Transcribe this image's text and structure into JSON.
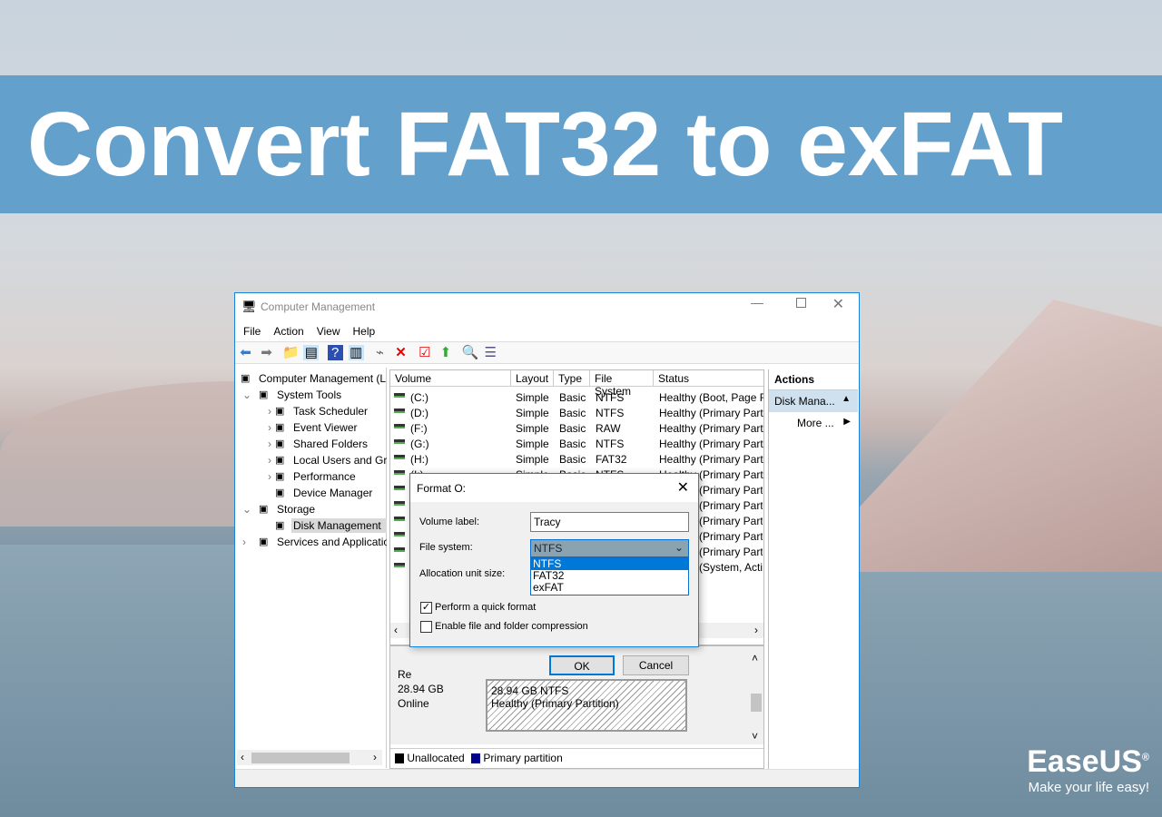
{
  "banner": {
    "title": "Convert FAT32 to exFAT"
  },
  "window": {
    "title": "Computer Management",
    "menu": [
      "File",
      "Action",
      "View",
      "Help"
    ]
  },
  "tree": [
    {
      "label": "Computer Management (L",
      "indent": 0,
      "arrow": ""
    },
    {
      "label": "System Tools",
      "indent": 1,
      "arrow": "v"
    },
    {
      "label": "Task Scheduler",
      "indent": 2,
      "arrow": ">"
    },
    {
      "label": "Event Viewer",
      "indent": 2,
      "arrow": ">"
    },
    {
      "label": "Shared Folders",
      "indent": 2,
      "arrow": ">"
    },
    {
      "label": "Local Users and Gro",
      "indent": 2,
      "arrow": ">"
    },
    {
      "label": "Performance",
      "indent": 2,
      "arrow": ">"
    },
    {
      "label": "Device Manager",
      "indent": 2,
      "arrow": ""
    },
    {
      "label": "Storage",
      "indent": 1,
      "arrow": "v"
    },
    {
      "label": "Disk Management",
      "indent": 2,
      "arrow": "",
      "selected": true
    },
    {
      "label": "Services and Applicatio",
      "indent": 1,
      "arrow": ">"
    }
  ],
  "table": {
    "headers": [
      "Volume",
      "Layout",
      "Type",
      "File System",
      "Status"
    ],
    "rows": [
      [
        "(C:)",
        "Simple",
        "Basic",
        "NTFS",
        "Healthy (Boot, Page F"
      ],
      [
        "(D:)",
        "Simple",
        "Basic",
        "NTFS",
        "Healthy (Primary Part"
      ],
      [
        "(F:)",
        "Simple",
        "Basic",
        "RAW",
        "Healthy (Primary Part"
      ],
      [
        "(G:)",
        "Simple",
        "Basic",
        "NTFS",
        "Healthy (Primary Part"
      ],
      [
        "(H:)",
        "Simple",
        "Basic",
        "FAT32",
        "Healthy (Primary Part"
      ],
      [
        "(I:)",
        "Simple",
        "Basic",
        "NTFS",
        "Healthy (Primary Part"
      ]
    ],
    "partial_status": [
      "(Primary Part",
      "(Primary Part",
      "(Primary Part",
      "(Primary Part",
      "(Primary Part",
      "(System, Acti"
    ]
  },
  "disk": {
    "name": "Re",
    "size": "28.94 GB",
    "state": "Online",
    "partition_size": "28.94 GB NTFS",
    "partition_status": "Healthy (Primary Partition)"
  },
  "legend": [
    "Unallocated",
    "Primary partition"
  ],
  "actions": {
    "header": "Actions",
    "section": "Disk Mana...",
    "more": "More ..."
  },
  "dialog": {
    "title": "Format O:",
    "volume_label_label": "Volume label:",
    "volume_label_value": "Tracy",
    "file_system_label": "File system:",
    "file_system_value": "NTFS",
    "options": [
      "NTFS",
      "FAT32",
      "exFAT"
    ],
    "allocation_label": "Allocation unit size:",
    "quick_format": "Perform a quick format",
    "compression": "Enable file and folder compression",
    "ok": "OK",
    "cancel": "Cancel"
  },
  "brand": {
    "name": "EaseUS",
    "tagline": "Make your life easy!",
    "reg": "®"
  }
}
